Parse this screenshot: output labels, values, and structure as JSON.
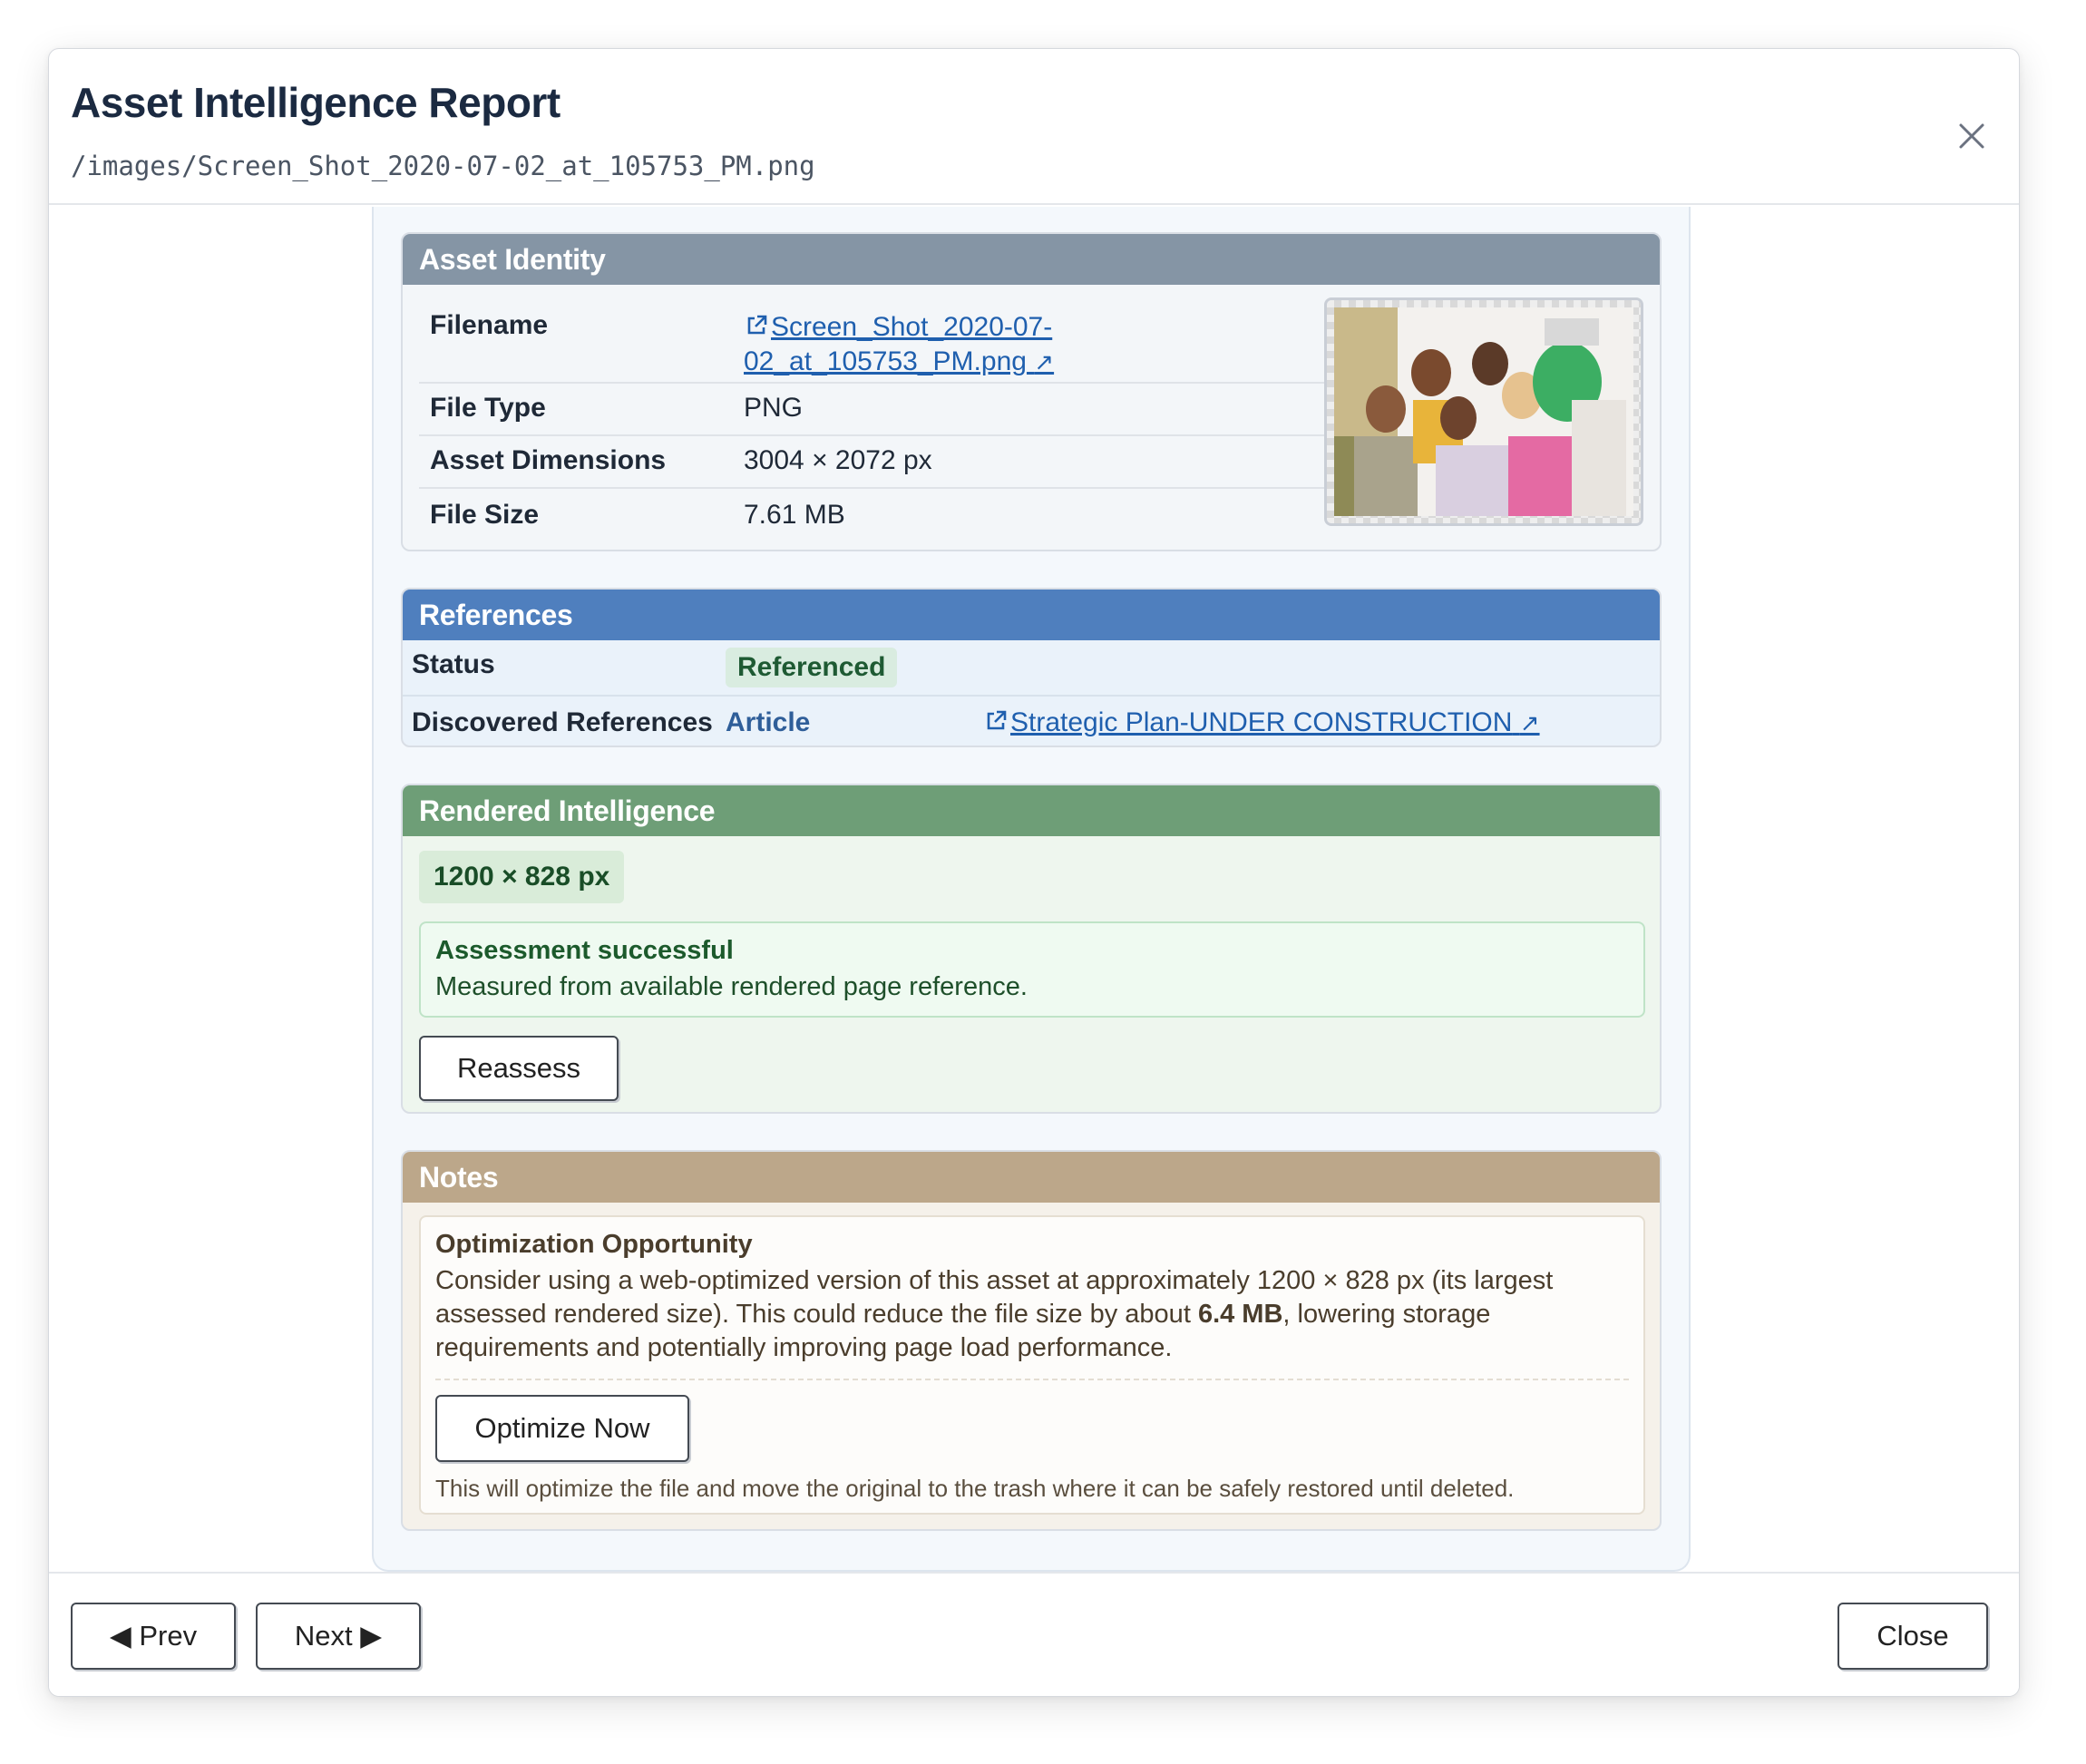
{
  "header": {
    "title": "Asset Intelligence Report",
    "path": "/images/Screen_Shot_2020-07-02_at_105753_PM.png"
  },
  "identity": {
    "heading": "Asset Identity",
    "filename_label": "Filename",
    "filename_value": "Screen_Shot_2020-07-02_at_105753_PM.png",
    "filetype_label": "File Type",
    "filetype_value": "PNG",
    "dimensions_label": "Asset Dimensions",
    "dimensions_value": "3004 × 2072 px",
    "filesize_label": "File Size",
    "filesize_value": "7.61 MB"
  },
  "references": {
    "heading": "References",
    "status_label": "Status",
    "status_value": "Referenced",
    "discovered_label": "Discovered References",
    "ref_type": "Article",
    "ref_title": "Strategic Plan-UNDER CONSTRUCTION"
  },
  "rendered": {
    "heading": "Rendered Intelligence",
    "dimensions": "1200 × 828 px",
    "success_title": "Assessment successful",
    "success_message": "Measured from available rendered page reference.",
    "reassess_label": "Reassess"
  },
  "notes": {
    "heading": "Notes",
    "title": "Optimization Opportunity",
    "text_before": "Consider using a web-optimized version of this asset at approximately 1200 × 828 px (its largest assessed rendered size). This could reduce the file size by about ",
    "savings": "6.4 MB",
    "text_after": ", lowering storage requirements and potentially improving page load performance.",
    "optimize_label": "Optimize Now",
    "footnote": "This will optimize the file and move the original to the trash where it can be safely restored until deleted."
  },
  "footer": {
    "prev_label": "◀ Prev",
    "next_label": "Next ▶",
    "close_label": "Close"
  },
  "icons": {
    "close": "close-icon",
    "external_link": "external-link-icon",
    "arrow": "↗"
  },
  "colors": {
    "identity_header": "#8595a5",
    "references_header": "#4f7fbe",
    "rendered_header": "#6e9e77",
    "notes_header": "#bca78a",
    "link": "#1f5fae"
  }
}
